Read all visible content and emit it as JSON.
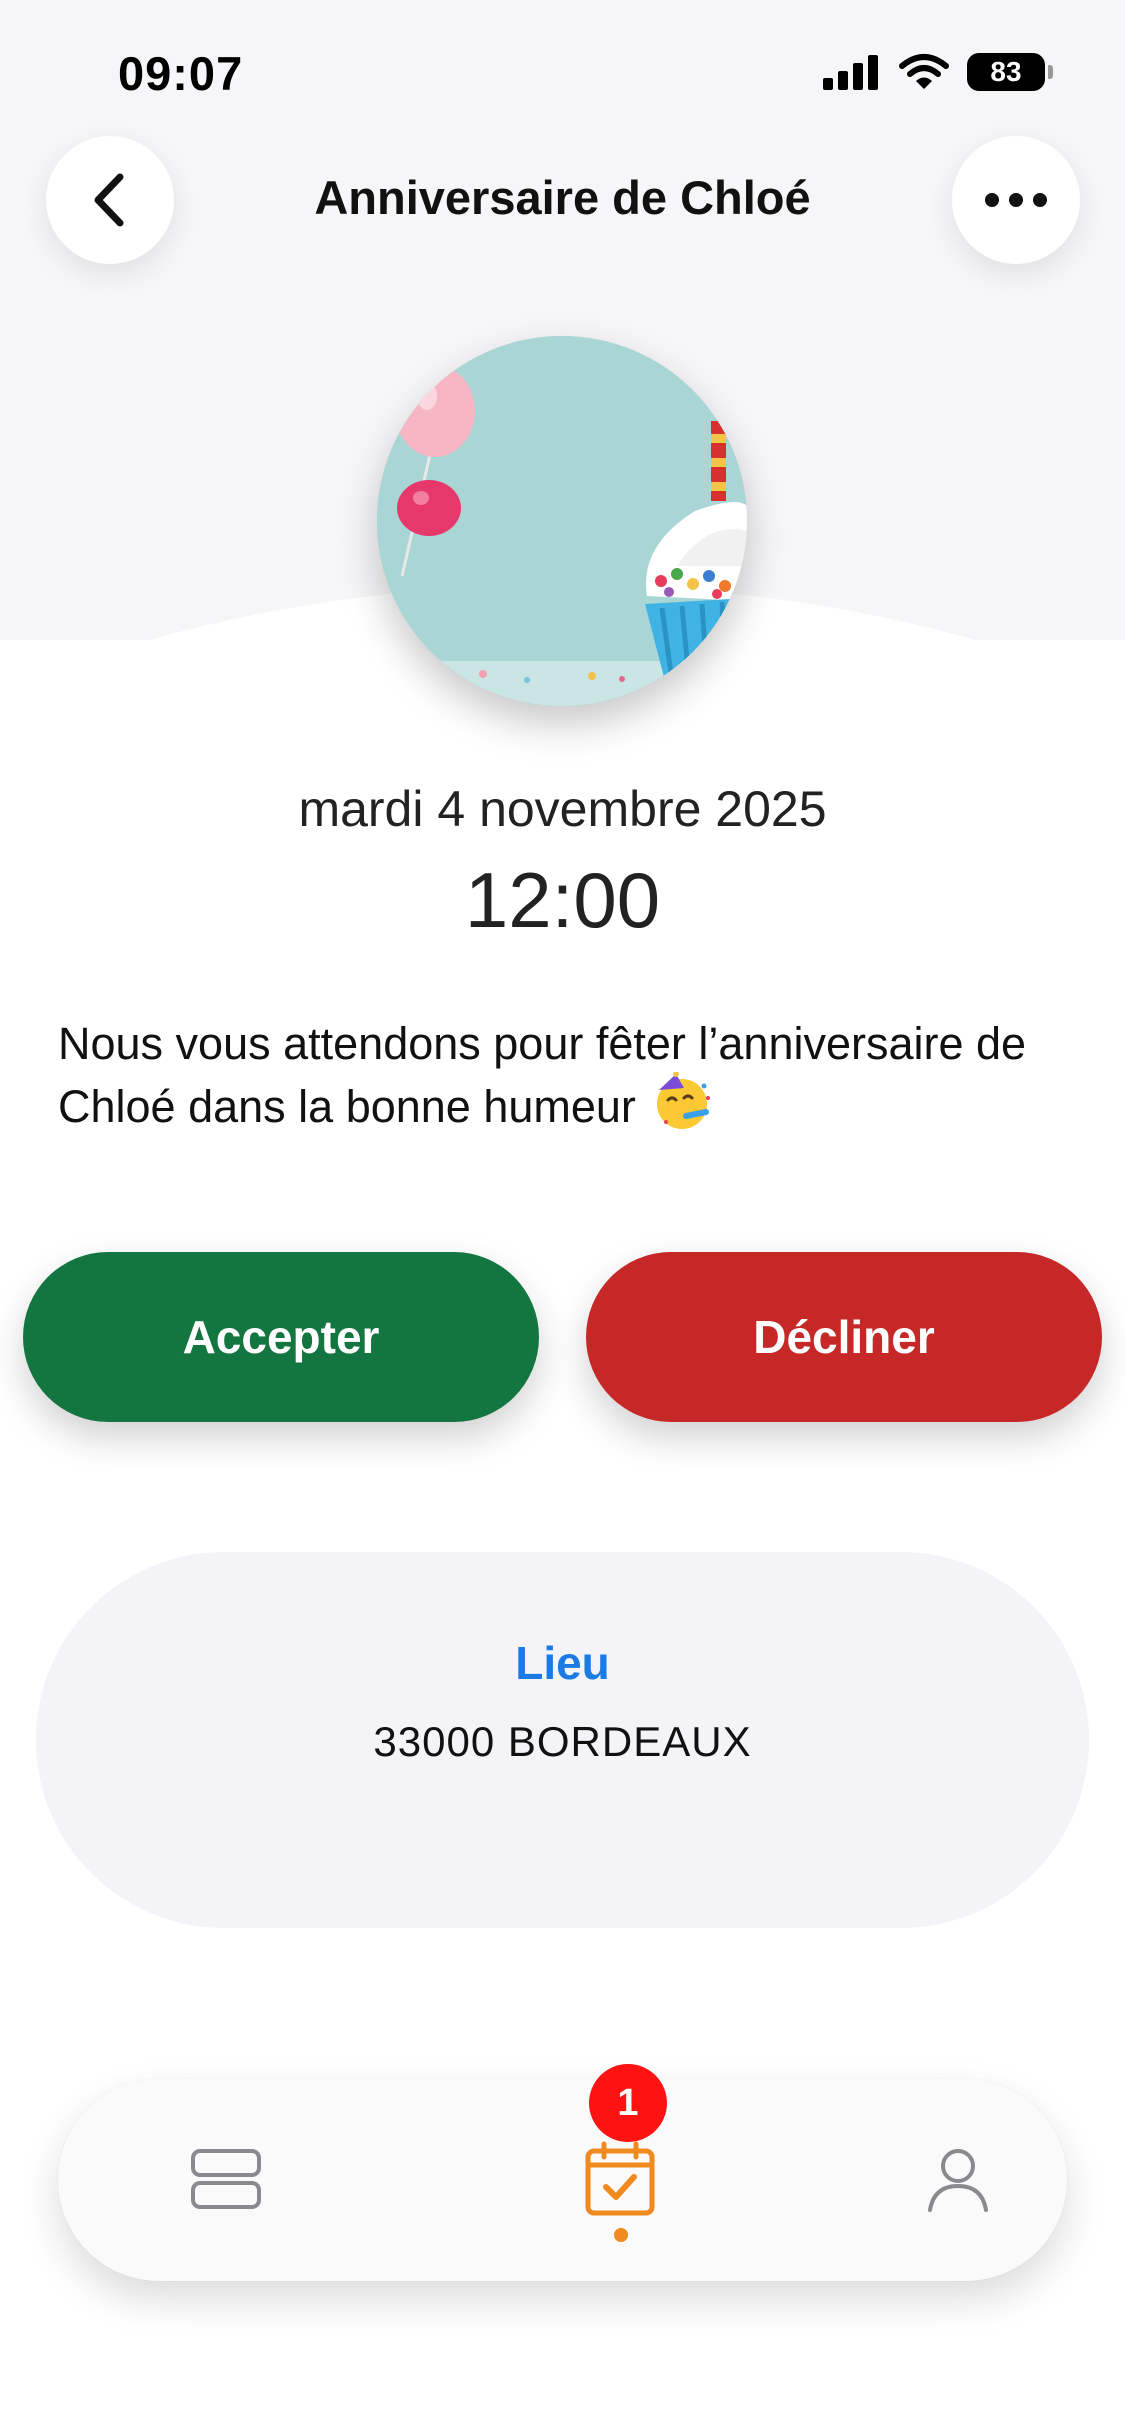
{
  "status_bar": {
    "time": "09:07",
    "battery": "83"
  },
  "header": {
    "title": "Anniversaire de Chloé"
  },
  "event": {
    "date": "mardi 4 novembre 2025",
    "time": "12:00",
    "description": "Nous vous attendons pour fêter l’anniversaire de Chloé dans la bonne humeur",
    "image": "birthday-cupcake-balloons"
  },
  "actions": {
    "accept_label": "Accepter",
    "decline_label": "Décliner"
  },
  "place": {
    "title": "Lieu",
    "value": "33000 BORDEAUX"
  },
  "tabbar": {
    "items": [
      {
        "icon": "feed-icon",
        "active": false
      },
      {
        "icon": "calendar-check-icon",
        "active": true
      },
      {
        "icon": "profile-icon",
        "active": false
      }
    ],
    "badge": "1"
  },
  "colors": {
    "accept": "#137540",
    "decline": "#c62828",
    "link": "#1b7be4",
    "active_tab": "#f08a1f",
    "badge": "#ff1212"
  }
}
